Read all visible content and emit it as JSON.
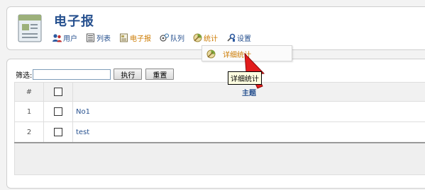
{
  "app": {
    "title": "电子报"
  },
  "nav": [
    {
      "label": "用户",
      "icon": "users-icon",
      "color": "#27518f"
    },
    {
      "label": "列表",
      "icon": "list-icon",
      "color": "#27518f"
    },
    {
      "label": "电子报",
      "icon": "newsletter-icon",
      "color": "#cc7a00"
    },
    {
      "label": "队列",
      "icon": "queue-icon",
      "color": "#27518f"
    },
    {
      "label": "统计",
      "icon": "statistics-icon",
      "color": "#cc7a00"
    },
    {
      "label": "设置",
      "icon": "settings-icon",
      "color": "#27518f"
    }
  ],
  "dropdown": {
    "item_label": "详细统计",
    "icon": "statistics-icon"
  },
  "tooltip": {
    "text": "详细统计"
  },
  "filter": {
    "label": "筛选:",
    "value": "",
    "execute_label": "执行",
    "reset_label": "重置"
  },
  "table": {
    "headers": {
      "number": "#",
      "subject": "主题"
    },
    "rows": [
      {
        "number": "1",
        "subject": "No1"
      },
      {
        "number": "2",
        "subject": "test"
      }
    ]
  }
}
